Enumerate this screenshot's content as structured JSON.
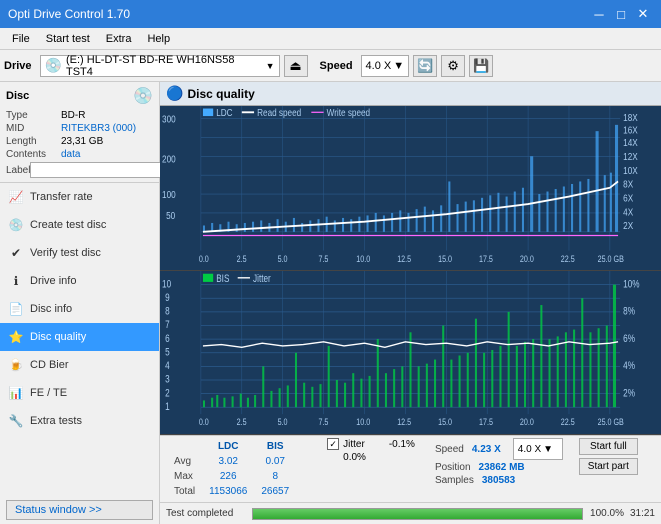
{
  "titlebar": {
    "title": "Opti Drive Control 1.70",
    "minimize": "─",
    "maximize": "□",
    "close": "✕"
  },
  "menubar": {
    "items": [
      "File",
      "Start test",
      "Extra",
      "Help"
    ]
  },
  "toolbar": {
    "drive_label": "Drive",
    "drive_value": "(E:)  HL-DT-ST BD-RE  WH16NS58 TST4",
    "speed_label": "Speed",
    "speed_value": "4.0 X"
  },
  "disc_panel": {
    "title": "Disc",
    "type_label": "Type",
    "type_value": "BD-R",
    "mid_label": "MID",
    "mid_value": "RITEKBR3 (000)",
    "length_label": "Length",
    "length_value": "23,31 GB",
    "contents_label": "Contents",
    "contents_value": "data",
    "label_label": "Label",
    "label_value": ""
  },
  "sidebar_nav": {
    "items": [
      {
        "id": "transfer-rate",
        "label": "Transfer rate",
        "icon": "📈"
      },
      {
        "id": "create-test-disc",
        "label": "Create test disc",
        "icon": "💿"
      },
      {
        "id": "verify-test-disc",
        "label": "Verify test disc",
        "icon": "✔"
      },
      {
        "id": "drive-info",
        "label": "Drive info",
        "icon": "ℹ"
      },
      {
        "id": "disc-info",
        "label": "Disc info",
        "icon": "📄"
      },
      {
        "id": "disc-quality",
        "label": "Disc quality",
        "icon": "⭐",
        "active": true
      },
      {
        "id": "cd-bier",
        "label": "CD Bier",
        "icon": "🍺"
      },
      {
        "id": "fe-te",
        "label": "FE / TE",
        "icon": "📊"
      },
      {
        "id": "extra-tests",
        "label": "Extra tests",
        "icon": "🔧"
      }
    ],
    "status_window": "Status window >>"
  },
  "disc_quality": {
    "title": "Disc quality",
    "legend": {
      "ldc": "LDC",
      "read_speed": "Read speed",
      "write_speed": "Write speed",
      "bis": "BIS",
      "jitter": "Jitter"
    },
    "chart1": {
      "y_max": 300,
      "y_labels_left": [
        "300",
        "200",
        "100",
        "50"
      ],
      "y_labels_right": [
        "18X",
        "16X",
        "14X",
        "12X",
        "10X",
        "8X",
        "6X",
        "4X",
        "2X"
      ],
      "x_labels": [
        "0.0",
        "2.5",
        "5.0",
        "7.5",
        "10.0",
        "12.5",
        "15.0",
        "17.5",
        "20.0",
        "22.5",
        "25.0 GB"
      ]
    },
    "chart2": {
      "y_max": 10,
      "y_labels_left": [
        "10",
        "9",
        "8",
        "7",
        "6",
        "5",
        "4",
        "3",
        "2",
        "1"
      ],
      "y_labels_right": [
        "10%",
        "8%",
        "6%",
        "4%",
        "2%"
      ],
      "x_labels": [
        "0.0",
        "2.5",
        "5.0",
        "7.5",
        "10.0",
        "12.5",
        "15.0",
        "17.5",
        "20.0",
        "22.5",
        "25.0 GB"
      ]
    }
  },
  "stats": {
    "headers": [
      "LDC",
      "BIS"
    ],
    "jitter_label": "Jitter",
    "jitter_checked": true,
    "rows": [
      {
        "label": "Avg",
        "ldc": "3.02",
        "bis": "0.07",
        "jitter": "-0.1%"
      },
      {
        "label": "Max",
        "ldc": "226",
        "bis": "8",
        "jitter": "0.0%"
      },
      {
        "label": "Total",
        "ldc": "1153066",
        "bis": "26657",
        "jitter": ""
      }
    ],
    "speed_label": "Speed",
    "speed_value": "4.23 X",
    "speed_select": "4.0 X",
    "position_label": "Position",
    "position_value": "23862 MB",
    "samples_label": "Samples",
    "samples_value": "380583",
    "start_full": "Start full",
    "start_part": "Start part"
  },
  "progress": {
    "label": "Test completed",
    "percent": 100,
    "percent_text": "100.0%",
    "time": "31:21"
  }
}
